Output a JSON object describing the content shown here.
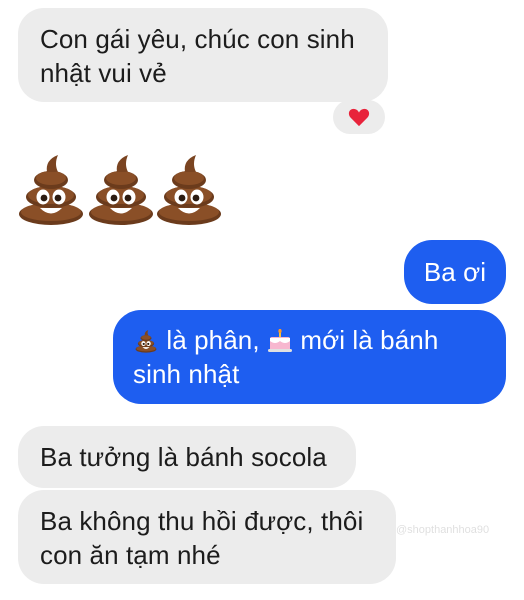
{
  "messages": {
    "m1": {
      "text": "Con gái yêu, chúc con sinh nhật vui vẻ",
      "sender": "incoming"
    },
    "m1_reaction": {
      "icon": "heart-icon",
      "color": "#e8233b"
    },
    "m_poop": {
      "icons": [
        "poop-icon",
        "poop-icon",
        "poop-icon"
      ],
      "sender": "incoming"
    },
    "m2": {
      "text": "Ba ơi",
      "sender": "outgoing"
    },
    "m3": {
      "icon1": "poop-icon",
      "part1": "là phân,",
      "icon2": "birthday-cake-icon",
      "part2": "mới là bánh sinh nhật",
      "sender": "outgoing"
    },
    "m4": {
      "text": "Ba tưởng là bánh socola",
      "sender": "incoming"
    },
    "m5": {
      "text": "Ba không thu hồi được, thôi con ăn tạm nhé",
      "sender": "incoming"
    }
  },
  "watermark": {
    "text": "@shopthanhhoa90"
  },
  "colors": {
    "incoming_bubble": "#ececec",
    "outgoing_bubble": "#1e5ef0",
    "heart": "#e8233b"
  }
}
